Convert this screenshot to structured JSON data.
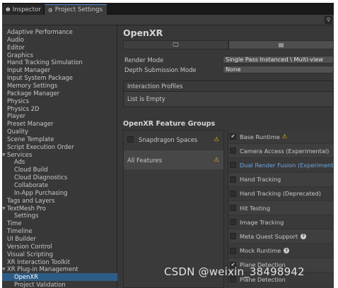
{
  "tabs": {
    "inspector": {
      "label": "Inspector",
      "icon": "info-icon"
    },
    "project_settings": {
      "label": "Project Settings",
      "icon": "gear-icon"
    }
  },
  "toolbar": {
    "search_icon": "search-icon"
  },
  "sidebar": {
    "items": [
      {
        "label": "Adaptive Performance",
        "level": 0
      },
      {
        "label": "Audio",
        "level": 0
      },
      {
        "label": "Editor",
        "level": 0
      },
      {
        "label": "Graphics",
        "level": 0
      },
      {
        "label": "Hand Tracking Simulation",
        "level": 0
      },
      {
        "label": "Input Manager",
        "level": 0
      },
      {
        "label": "Input System Package",
        "level": 0
      },
      {
        "label": "Memory Settings",
        "level": 0
      },
      {
        "label": "Package Manager",
        "level": 0
      },
      {
        "label": "Physics",
        "level": 0
      },
      {
        "label": "Physics 2D",
        "level": 0
      },
      {
        "label": "Player",
        "level": 0
      },
      {
        "label": "Preset Manager",
        "level": 0
      },
      {
        "label": "Quality",
        "level": 0
      },
      {
        "label": "Scene Template",
        "level": 0
      },
      {
        "label": "Script Execution Order",
        "level": 0
      },
      {
        "label": "Services",
        "level": 0,
        "expanded": true
      },
      {
        "label": "Ads",
        "level": 1
      },
      {
        "label": "Cloud Build",
        "level": 1
      },
      {
        "label": "Cloud Diagnostics",
        "level": 1
      },
      {
        "label": "Collaborate",
        "level": 1
      },
      {
        "label": "In-App Purchasing",
        "level": 1
      },
      {
        "label": "Tags and Layers",
        "level": 0
      },
      {
        "label": "TextMesh Pro",
        "level": 0,
        "expanded": true
      },
      {
        "label": "Settings",
        "level": 1
      },
      {
        "label": "Time",
        "level": 0
      },
      {
        "label": "Timeline",
        "level": 0
      },
      {
        "label": "UI Builder",
        "level": 0
      },
      {
        "label": "Version Control",
        "level": 0
      },
      {
        "label": "Visual Scripting",
        "level": 0
      },
      {
        "label": "XR Interaction Toolkit",
        "level": 0
      },
      {
        "label": "XR Plug-in Management",
        "level": 0,
        "expanded": true
      },
      {
        "label": "OpenXR",
        "level": 1,
        "selected": true
      },
      {
        "label": "Project Validation",
        "level": 1
      }
    ]
  },
  "main": {
    "title": "OpenXR",
    "platform_tabs": [
      {
        "icon": "monitor-icon",
        "glyph": "🖵"
      },
      {
        "icon": "android-icon",
        "glyph": "▤"
      }
    ],
    "render_mode": {
      "label": "Render Mode",
      "value": "Single Pass Instanced \\ Multi-view"
    },
    "depth_submission_mode": {
      "label": "Depth Submission Mode",
      "value": "None"
    },
    "interaction_profiles": {
      "header": "Interaction Profiles",
      "empty_text": "List is Empty"
    },
    "feature_groups_title": "OpenXR Feature Groups",
    "feature_groups": [
      {
        "label": "Snapdragon Spaces",
        "checked": false,
        "warning": true
      },
      {
        "label": "All Features",
        "warning": true,
        "selected": true
      }
    ],
    "features": [
      {
        "label": "Base Runtime",
        "checked": true,
        "warning": true
      },
      {
        "label": "Camera Access (Experimental)",
        "checked": false
      },
      {
        "label": "Dual Render Fusion (Experimental)",
        "checked": false,
        "highlight": true
      },
      {
        "label": "Hand Tracking",
        "checked": false
      },
      {
        "label": "Hand Tracking (Deprecated)",
        "checked": false
      },
      {
        "label": "Hit Testing",
        "checked": false
      },
      {
        "label": "Image Tracking",
        "checked": false
      },
      {
        "label": "Meta Quest Support",
        "checked": false,
        "help": true
      },
      {
        "label": "Mock Runtime",
        "checked": false,
        "help": true
      },
      {
        "label": "Plane Detection",
        "checked": true
      },
      {
        "label": "Plane Detection",
        "checked": false
      }
    ]
  },
  "watermark": "CSDN @weixin_38498942",
  "colors": {
    "selection": "#2c5d87",
    "warning": "#e6b21c",
    "link": "#6ea6e8",
    "background": "#383838"
  }
}
